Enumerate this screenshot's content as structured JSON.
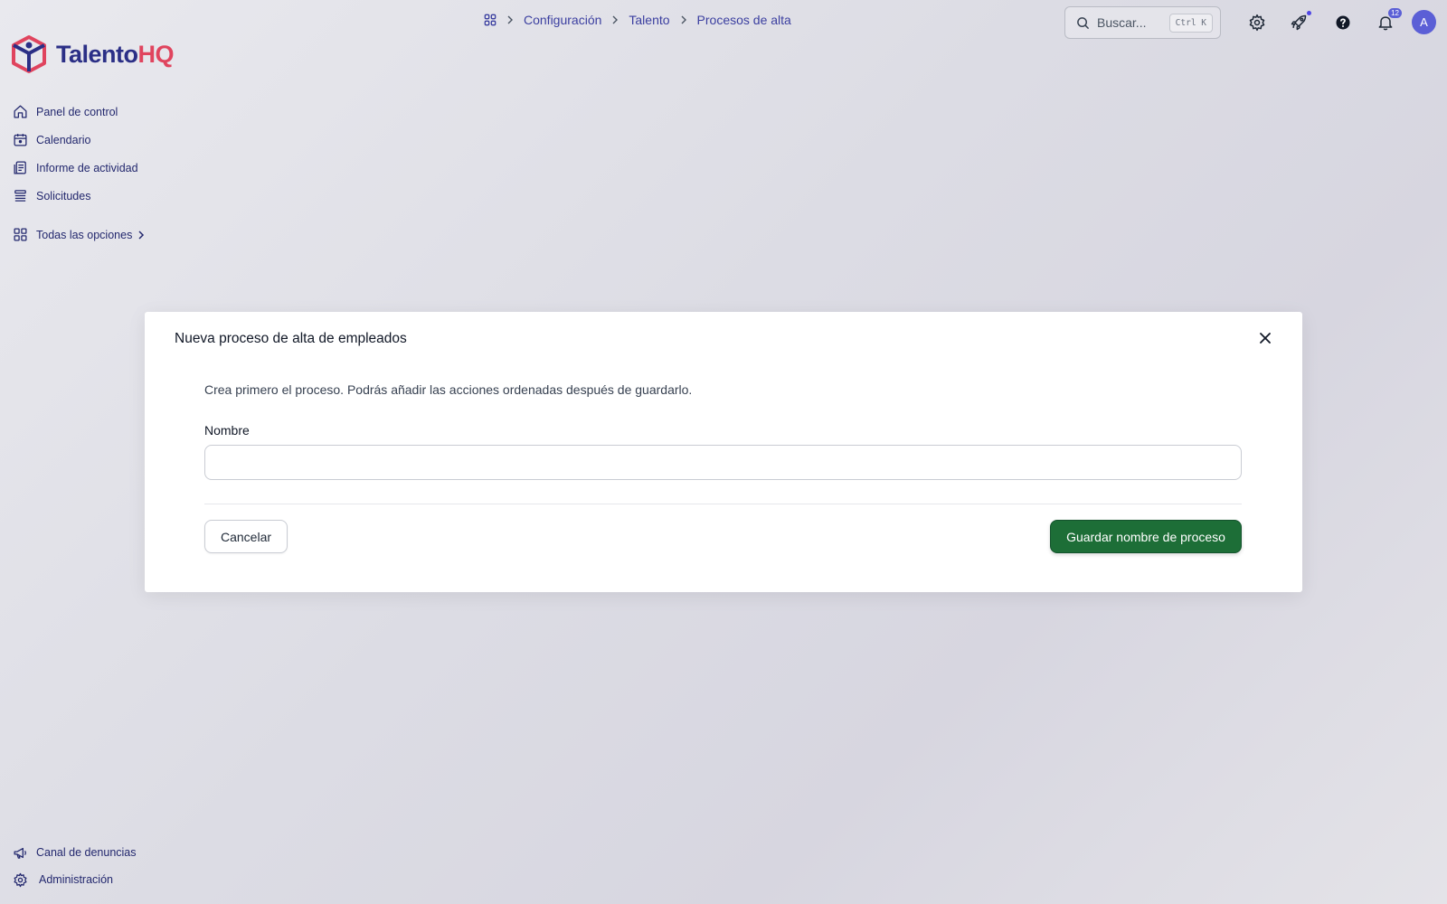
{
  "app": {
    "logo_part1": "Talento",
    "logo_part2": "HQ",
    "brand_colors": {
      "primary": "#2b2f86",
      "accent": "#e0445e"
    }
  },
  "sidebar": {
    "items": [
      {
        "label": "Panel de control",
        "icon": "home-icon"
      },
      {
        "label": "Calendario",
        "icon": "calendar-icon"
      },
      {
        "label": "Informe de actividad",
        "icon": "report-icon"
      },
      {
        "label": "Solicitudes",
        "icon": "list-icon"
      }
    ],
    "all_options": {
      "label": "Todas las opciones",
      "icon": "grid-icon"
    },
    "bottom": [
      {
        "label": "Canal de denuncias",
        "icon": "megaphone-icon"
      },
      {
        "label": "Administración",
        "icon": "gear-icon"
      }
    ]
  },
  "breadcrumb": {
    "items": [
      "Configuración",
      "Talento",
      "Procesos de alta"
    ]
  },
  "search": {
    "placeholder": "Buscar...",
    "shortcut": "Ctrl K"
  },
  "header": {
    "notifications_count": "12",
    "avatar_initial": "A"
  },
  "modal": {
    "title": "Nueva proceso de alta de empleados",
    "description": "Crea primero el proceso. Podrás añadir las acciones ordenadas después de guardarlo.",
    "field_label": "Nombre",
    "field_value": "",
    "cancel_label": "Cancelar",
    "save_label": "Guardar nombre de proceso",
    "save_color": "#1d6e37"
  }
}
